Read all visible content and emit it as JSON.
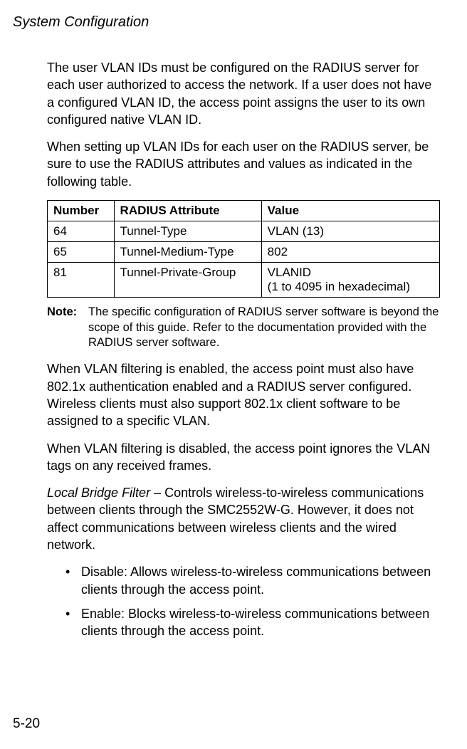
{
  "header": {
    "title": "System Configuration"
  },
  "paragraphs": {
    "p1": "The user VLAN IDs must be configured on the RADIUS server for each user authorized to access the network. If a user does not have a configured VLAN ID, the access point assigns the user to its own configured native VLAN ID.",
    "p2": "When setting up VLAN IDs for each user on the RADIUS server, be sure to use the RADIUS attributes and values as indicated in the following table.",
    "p3": "When VLAN filtering is enabled, the access point must also have 802.1x authentication enabled and a RADIUS server configured. Wireless clients must also support 802.1x client software to be assigned to a specific VLAN.",
    "p4": "When VLAN filtering is disabled, the access point ignores the VLAN tags on any received frames.",
    "p5_prefix": "Local Bridge Filter",
    "p5_rest": " – Controls wireless-to-wireless communications between clients through the SMC2552W-G. However, it does not affect communications between wireless clients and the wired network."
  },
  "table": {
    "headers": {
      "col1": "Number",
      "col2": "RADIUS Attribute",
      "col3": "Value"
    },
    "rows": [
      {
        "number": "64",
        "attribute": "Tunnel-Type",
        "value": "VLAN (13)"
      },
      {
        "number": "65",
        "attribute": "Tunnel-Medium-Type",
        "value": "802"
      },
      {
        "number": "81",
        "attribute": "Tunnel-Private-Group",
        "value": "VLANID\n(1 to 4095 in hexadecimal)"
      }
    ]
  },
  "note": {
    "label": "Note:",
    "text": "The specific configuration of RADIUS server software is beyond the scope of this guide. Refer to the documentation provided with the RADIUS server software."
  },
  "bullets": [
    "Disable: Allows wireless-to-wireless communications between clients through the access point.",
    "Enable: Blocks wireless-to-wireless communications between clients through the access point."
  ],
  "footer": {
    "page_number": "5-20"
  }
}
